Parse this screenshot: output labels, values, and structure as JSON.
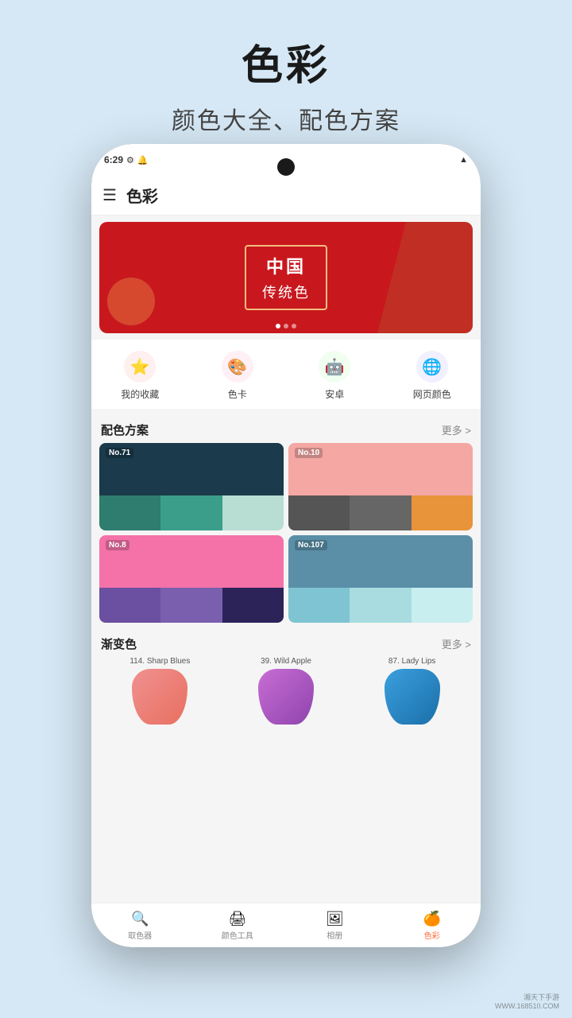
{
  "page": {
    "background_color": "#d6e8f5",
    "title": "色彩",
    "subtitle": "颜色大全、配色方案"
  },
  "status_bar": {
    "time": "6:29",
    "icons": [
      "settings",
      "notification",
      "signal"
    ]
  },
  "app_bar": {
    "title": "色彩",
    "menu_icon": "☰"
  },
  "banner": {
    "title": "中国",
    "subtitle": "传统色",
    "dot_count": 3,
    "active_dot": 0
  },
  "quick_nav": {
    "items": [
      {
        "id": "favorites",
        "icon": "⭐",
        "label": "我的收藏",
        "color": "#ff6b6b"
      },
      {
        "id": "color-card",
        "icon": "🎨",
        "label": "色卡",
        "color": "#ff8c94"
      },
      {
        "id": "android",
        "icon": "🤖",
        "label": "安卓",
        "color": "#4caf50"
      },
      {
        "id": "web-colors",
        "icon": "🌐",
        "label": "网页颜色",
        "color": "#2196f3"
      }
    ]
  },
  "section_palette": {
    "title": "配色方案",
    "more_label": "更多 >"
  },
  "palettes": [
    {
      "id": "no71",
      "label": "No.71",
      "rows": [
        [
          {
            "color": "#1b3a4b"
          },
          {
            "color": "#1b3a4b"
          },
          {
            "color": "#1b3a4b"
          }
        ],
        [
          {
            "color": "#2e7d6e"
          },
          {
            "color": "#3a9e8a"
          },
          {
            "color": "#b8ddd3"
          }
        ]
      ]
    },
    {
      "id": "no10",
      "label": "No.10",
      "rows": [
        [
          {
            "color": "#f4a7a3"
          },
          {
            "color": "#f4a7a3"
          },
          {
            "color": "#f4a7a3"
          }
        ],
        [
          {
            "color": "#555"
          },
          {
            "color": "#555"
          },
          {
            "color": "#e8943a"
          }
        ]
      ]
    },
    {
      "id": "no8",
      "label": "No.8",
      "rows": [
        [
          {
            "color": "#f472a8"
          },
          {
            "color": "#f472a8"
          },
          {
            "color": "#f472a8"
          }
        ],
        [
          {
            "color": "#6b4fa0"
          },
          {
            "color": "#7b5faf"
          },
          {
            "color": "#2c2358"
          }
        ]
      ]
    },
    {
      "id": "no107",
      "label": "No.107",
      "rows": [
        [
          {
            "color": "#5b8fa8"
          },
          {
            "color": "#5b8fa8"
          },
          {
            "color": "#5b8fa8"
          }
        ],
        [
          {
            "color": "#7fc4d2"
          },
          {
            "color": "#a8dce0"
          },
          {
            "color": "#c8eef0"
          }
        ]
      ]
    }
  ],
  "section_gradient": {
    "title": "渐变色",
    "more_label": "更多 >"
  },
  "gradients": [
    {
      "id": "sharp-blues",
      "label": "114. Sharp Blues",
      "color_from": "#e87070",
      "color_to": "#e87070",
      "gradient_css": "linear-gradient(to bottom, #e87070, #e8a070)"
    },
    {
      "id": "wild-apple",
      "label": "39. Wild Apple",
      "color_from": "#c86dd4",
      "color_to": "#9b59b6",
      "gradient_css": "linear-gradient(to bottom, #c86dd4, #8e44ad)"
    },
    {
      "id": "lady-lips",
      "label": "87. Lady Lips",
      "color_from": "#3b9fde",
      "color_to": "#2980b9",
      "gradient_css": "linear-gradient(to bottom, #3b9fde, #1a6fa8)"
    }
  ],
  "bottom_nav": {
    "items": [
      {
        "id": "picker",
        "icon": "🔍",
        "label": "取色器",
        "active": false
      },
      {
        "id": "tools",
        "icon": "🖨",
        "label": "颜色工具",
        "active": false
      },
      {
        "id": "album",
        "icon": "🖼",
        "label": "相册",
        "active": false
      },
      {
        "id": "colors",
        "icon": "🍊",
        "label": "色彩",
        "active": true
      }
    ]
  },
  "watermark": "湘天下手游\nWWW.168510.COM"
}
